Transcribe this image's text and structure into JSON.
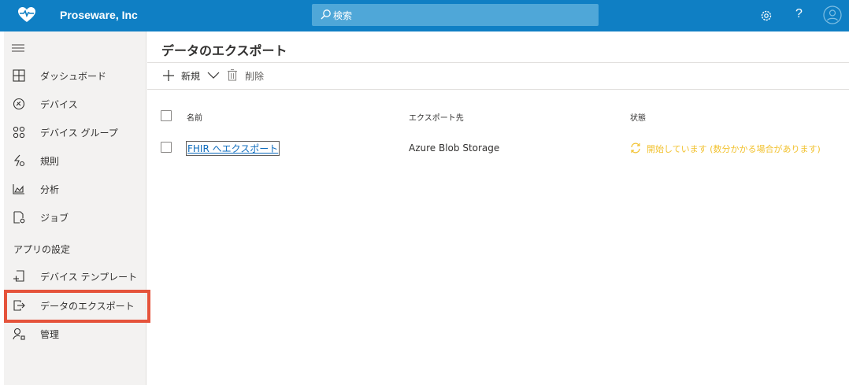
{
  "app": {
    "brand": "Proseware, Inc"
  },
  "header": {
    "search_placeholder": "検索",
    "help_label": "?"
  },
  "sidebar": {
    "items": [
      {
        "label": "ダッシュボード",
        "icon": "dashboard-icon"
      },
      {
        "label": "デバイス",
        "icon": "devices-icon"
      },
      {
        "label": "デバイス グループ",
        "icon": "device-groups-icon"
      },
      {
        "label": "規則",
        "icon": "rules-icon"
      },
      {
        "label": "分析",
        "icon": "analytics-icon"
      },
      {
        "label": "ジョブ",
        "icon": "jobs-icon"
      }
    ],
    "section_label": "アプリの設定",
    "settings_items": [
      {
        "label": "デバイス テンプレート",
        "icon": "device-template-icon"
      },
      {
        "label": "データのエクスポート",
        "icon": "data-export-icon",
        "active": true
      },
      {
        "label": "管理",
        "icon": "admin-icon"
      }
    ]
  },
  "main": {
    "title": "データのエクスポート",
    "commands": {
      "new_label": "新規",
      "delete_label": "削除"
    },
    "table": {
      "columns": [
        "名前",
        "エクスポート先",
        "状態"
      ],
      "rows": [
        {
          "name": "FHIR へエクスポート",
          "destination": "Azure Blob Storage",
          "status": "開始しています (数分かかる場合があります)"
        }
      ]
    }
  },
  "colors": {
    "topbar": "#0f7fc4",
    "highlight": "#e5533b",
    "status": "#f2c230",
    "link": "#0f6cbd"
  }
}
